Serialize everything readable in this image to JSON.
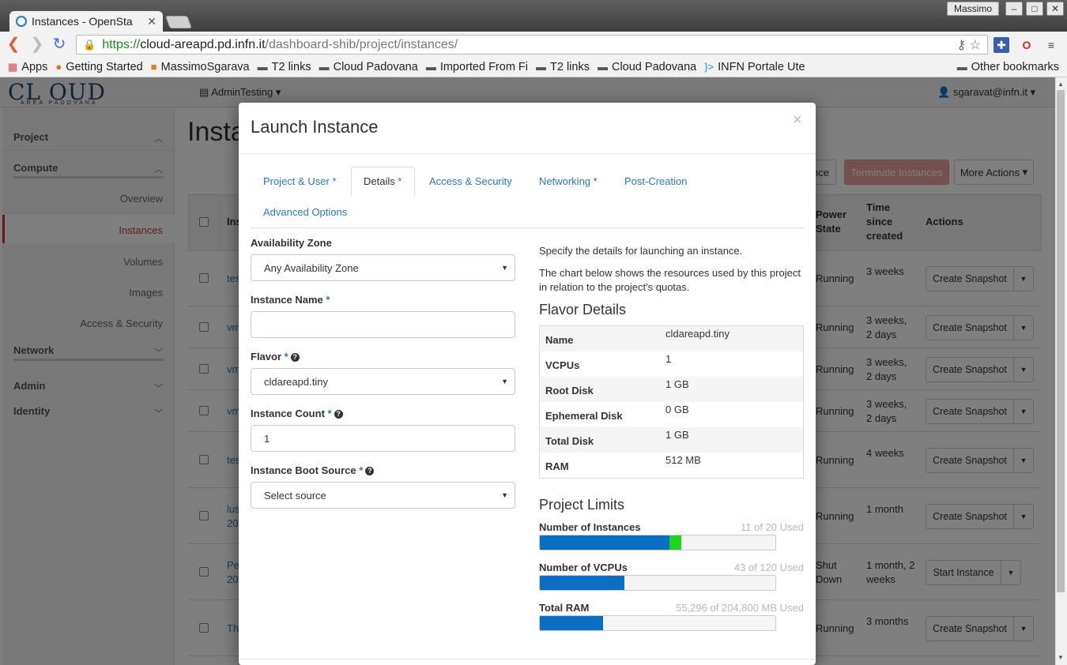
{
  "browser": {
    "tab_title": "Instances - OpenSta",
    "user": "Massimo",
    "window_controls": [
      "–",
      "□",
      "✕"
    ],
    "url_scheme": "https://",
    "url_host": "cloud-areapd.pd.infn.it",
    "url_path": "/dashboard-shib/project/instances/",
    "bookmarks": [
      "Apps",
      "Getting Started",
      "MassimoSgarava",
      "T2 links",
      "Cloud Padovana",
      "Imported From Fi",
      "T2 links",
      "Cloud Padovana",
      "INFN Portale Ute"
    ],
    "other_bookmarks": "Other bookmarks"
  },
  "header": {
    "logo": "CL OUD",
    "logo_sub": "AREA PADOVANA",
    "project": "AdminTesting",
    "user": "sgaravat@infn.it"
  },
  "sidebar": {
    "project": "Project",
    "compute": "Compute",
    "items": [
      "Overview",
      "Instances",
      "Volumes",
      "Images",
      "Access & Security"
    ],
    "network": "Network",
    "admin": "Admin",
    "identity": "Identity"
  },
  "page": {
    "title": "Insta",
    "launch_partial": "nce",
    "terminate": "Terminate Instances",
    "more_actions": "More Actions",
    "columns": {
      "ins": "Ins",
      "power": "Power State",
      "time": "Time since created",
      "actions": "Actions"
    },
    "rows": [
      {
        "name": "tes",
        "power": "Running",
        "time": "3 weeks",
        "action": "Create Snapshot"
      },
      {
        "name": "vm",
        "power": "Running",
        "time": "3 weeks, 2 days",
        "action": "Create Snapshot"
      },
      {
        "name": "vm",
        "power": "Running",
        "time": "3 weeks, 2 days",
        "action": "Create Snapshot"
      },
      {
        "name": "vm",
        "power": "Running",
        "time": "3 weeks, 2 days",
        "action": "Create Snapshot"
      },
      {
        "name": "tes",
        "power": "Running",
        "time": "4 weeks",
        "action": "Create Snapshot"
      },
      {
        "name": "lus 20",
        "power": "Running",
        "time": "1 month",
        "action": "Create Snapshot"
      },
      {
        "name": "Pe 20",
        "power": "Shut Down",
        "time": "1 month, 2 weeks",
        "action": "Start Instance"
      },
      {
        "name": "Th",
        "power": "Running",
        "time": "3 months",
        "action": "Create Snapshot"
      }
    ]
  },
  "modal": {
    "title": "Launch Instance",
    "close": "×",
    "tabs": [
      "Project & User",
      "Details",
      "Access & Security",
      "Networking",
      "Post-Creation",
      "Advanced Options"
    ],
    "req": "*",
    "fields": {
      "availability_zone": {
        "label": "Availability Zone",
        "value": "Any Availability Zone"
      },
      "instance_name": {
        "label": "Instance Name",
        "value": ""
      },
      "flavor": {
        "label": "Flavor",
        "value": "cldareapd.tiny"
      },
      "instance_count": {
        "label": "Instance Count",
        "value": "1"
      },
      "boot_source": {
        "label": "Instance Boot Source",
        "value": "Select source"
      }
    },
    "help_text_1": "Specify the details for launching an instance.",
    "help_text_2": "The chart below shows the resources used by this project in relation to the project's quotas.",
    "flavor_details": {
      "heading": "Flavor Details",
      "rows": [
        {
          "key": "Name",
          "value": "cldareapd.tiny"
        },
        {
          "key": "VCPUs",
          "value": "1"
        },
        {
          "key": "Root Disk",
          "value": "1 GB"
        },
        {
          "key": "Ephemeral Disk",
          "value": "0 GB"
        },
        {
          "key": "Total Disk",
          "value": "1 GB"
        },
        {
          "key": "RAM",
          "value": "512 MB"
        }
      ]
    },
    "project_limits": {
      "heading": "Project Limits",
      "quotas": [
        {
          "label": "Number of Instances",
          "used_text": "11 of 20 Used",
          "used_fraction": 0.55,
          "added_fraction": 0.05
        },
        {
          "label": "Number of VCPUs",
          "used_text": "43 of 120 Used",
          "used_fraction": 0.36,
          "added_fraction": 0.0
        },
        {
          "label": "Total RAM",
          "used_text": "55,296 of 204,800 MB Used",
          "used_fraction": 0.27,
          "added_fraction": 0.0
        }
      ]
    }
  }
}
